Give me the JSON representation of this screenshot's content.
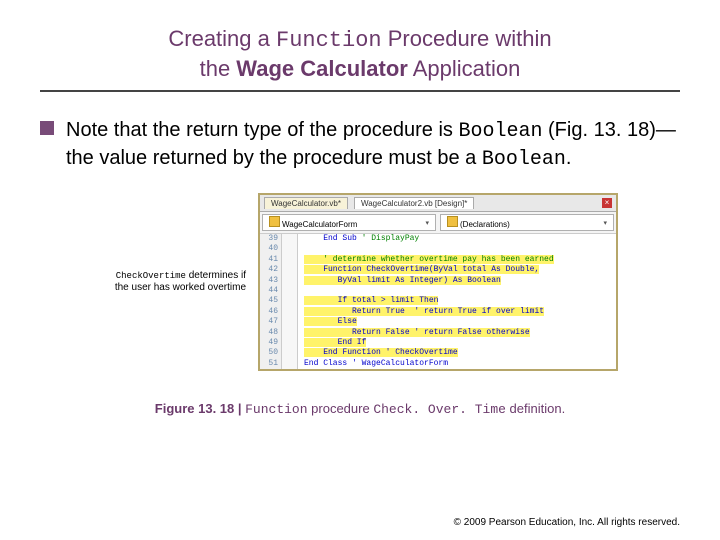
{
  "title": {
    "part1": "Creating a ",
    "function_word": "Function",
    "part2": " Procedure within",
    "part3": "the ",
    "app_name": "Wage Calculator",
    "part4": " Application"
  },
  "body": {
    "p1a": "Note that the return type of the procedure is ",
    "boolean1": "Boolean",
    "p1b": " (Fig. 13. 18)—the value returned by the procedure must be a ",
    "boolean2": "Boolean",
    "p1c": "."
  },
  "annotation": {
    "code_word": "CheckOvertime",
    "rest": " determines if the user has worked overtime"
  },
  "ide": {
    "tab1": "WageCalculator.vb*",
    "tab2": "WageCalculator2.vb [Design]*",
    "dropdown_left": "WageCalculatorForm",
    "dropdown_right": "(Declarations)",
    "icon_left_name": "class-icon",
    "icon_right_name": "declarations-icon",
    "lines": [
      {
        "n": "39",
        "text": "    End Sub",
        "cls": "kw",
        "after_comment": " ' DisplayPay"
      },
      {
        "n": "40",
        "text": " "
      },
      {
        "n": "41",
        "text": "    ' determine whether overtime pay has been earned",
        "cls": "cm",
        "hl": true
      },
      {
        "n": "42",
        "text": "    Function CheckOvertime(ByVal total As Double,",
        "cls": "kw",
        "hl": true
      },
      {
        "n": "43",
        "text": "       ByVal limit As Integer) As Boolean",
        "cls": "kw",
        "hl": true
      },
      {
        "n": "44",
        "text": " "
      },
      {
        "n": "45",
        "text": "       If total > limit Then",
        "cls": "kw",
        "hl": true
      },
      {
        "n": "46",
        "text": "          Return True  ' return True if over limit",
        "cls": "kw",
        "hl": true
      },
      {
        "n": "47",
        "text": "       Else",
        "cls": "kw",
        "hl": true
      },
      {
        "n": "48",
        "text": "          Return False ' return False otherwise",
        "cls": "kw",
        "hl": true
      },
      {
        "n": "49",
        "text": "       End If",
        "cls": "kw",
        "hl": true
      },
      {
        "n": "50",
        "text": "    End Function ' CheckOvertime",
        "cls": "kw",
        "hl": true
      },
      {
        "n": "51",
        "text": "End Class ' WageCalculatorForm",
        "cls": "kw"
      }
    ]
  },
  "caption": {
    "label": "Figure 13. 18 | ",
    "mono1": "Function",
    "mid": " procedure ",
    "mono2": "Check. Over. Time",
    "end": " definition."
  },
  "copyright": "© 2009 Pearson Education, Inc.  All rights reserved."
}
